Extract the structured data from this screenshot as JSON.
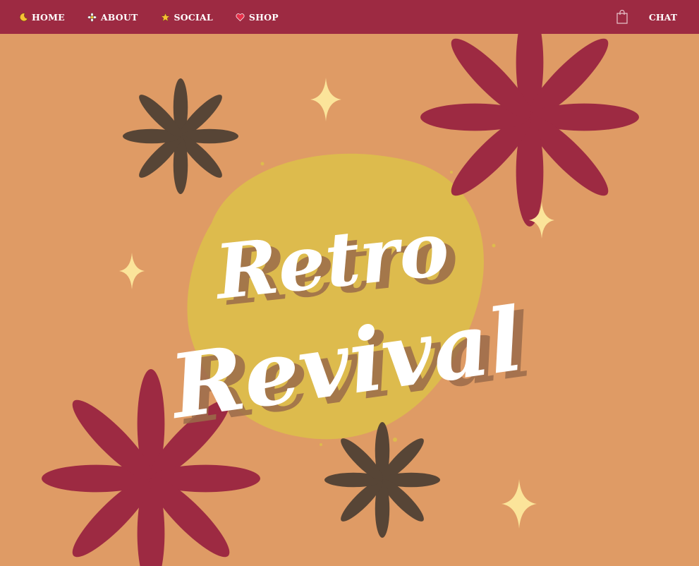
{
  "nav": {
    "items": [
      {
        "label": "HOME",
        "icon": "crescent-moon-icon"
      },
      {
        "label": "ABOUT",
        "icon": "daisy-flower-icon"
      },
      {
        "label": "SOCIAL",
        "icon": "star-icon"
      },
      {
        "label": "SHOP",
        "icon": "heart-icon"
      }
    ],
    "cart_icon": "shopping-bag-icon",
    "chat_label": "CHAT"
  },
  "hero": {
    "headline_line1": "Retro",
    "headline_line2": "Revival"
  },
  "colors": {
    "nav_bg": "#9d2a42",
    "page_bg": "#df9b65",
    "blob": "#ddbb4d",
    "text": "#ffffff",
    "text_shadow": "#9b6c4a",
    "flower_red": "#9d2a42",
    "flower_brown": "#574536",
    "sparkle": "#fbe49a"
  }
}
